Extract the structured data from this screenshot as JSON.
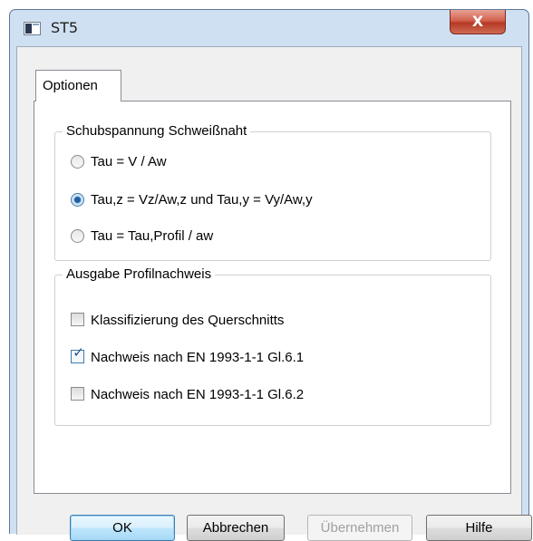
{
  "window": {
    "title": "ST5",
    "close_glyph": "X"
  },
  "tabs": [
    {
      "label": "Optionen",
      "selected": true
    }
  ],
  "shear_group": {
    "title": "Schubspannung Schweißnaht",
    "options": [
      {
        "label": "Tau = V / Aw",
        "selected": false
      },
      {
        "label": "Tau,z = Vz/Aw,z  und Tau,y = Vy/Aw,y",
        "selected": true
      },
      {
        "label": "Tau = Tau,Profil / aw",
        "selected": false
      }
    ]
  },
  "output_group": {
    "title": "Ausgabe Profilnachweis",
    "options": [
      {
        "label": "Klassifizierung des Querschnitts",
        "checked": false
      },
      {
        "label": "Nachweis nach EN 1993-1-1 Gl.6.1",
        "checked": true
      },
      {
        "label": "Nachweis nach EN 1993-1-1 Gl.6.2",
        "checked": false
      }
    ]
  },
  "buttons": {
    "ok": "OK",
    "cancel": "Abbrechen",
    "apply": "Übernehmen",
    "help": "Hilfe"
  },
  "icons": {
    "app": "app-window-icon",
    "close": "close-icon",
    "check": "checkmark-icon"
  },
  "colors": {
    "titlebar": "#cfe0f2",
    "close_button": "#c4493a",
    "accent": "#3c7fb1"
  }
}
